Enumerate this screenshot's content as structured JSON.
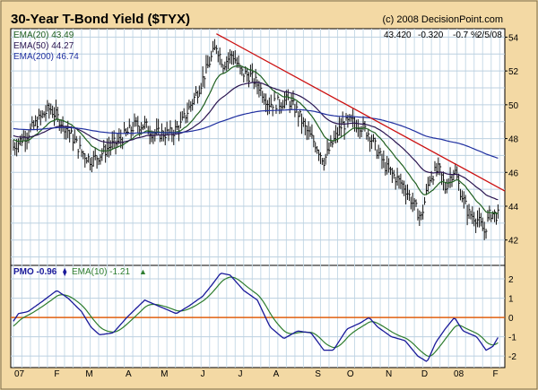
{
  "chart_data": {
    "type": "line",
    "title": "30-Year T-Bond Yield ($TYX)",
    "copyright": "(c) 2008 DecisionPoint.com",
    "quote": {
      "last": "43.420",
      "change": "-0.320",
      "pct": "-0.7 %",
      "date": "2/5/08"
    },
    "legend": [
      {
        "label": "EMA(20) 43.49",
        "color": "#1f5f1f",
        "period": 20
      },
      {
        "label": "EMA(50) 44.27",
        "color": "#2a1450",
        "period": 50
      },
      {
        "label": "EMA(200) 46.74",
        "color": "#2030a0",
        "period": 200
      }
    ],
    "price_ylim": [
      40.5,
      54.5
    ],
    "price_ticks": [
      "54",
      "52",
      "50",
      "48",
      "46",
      "44",
      "42"
    ],
    "xlim_weeks": [
      -0.3,
      57.6
    ],
    "month_labels": [
      {
        "label": "07",
        "week": 0.7
      },
      {
        "label": "F",
        "week": 5.1
      },
      {
        "label": "M",
        "week": 8.9
      },
      {
        "label": "A",
        "week": 13.5
      },
      {
        "label": "M",
        "week": 17.7
      },
      {
        "label": "J",
        "week": 22.2
      },
      {
        "label": "J",
        "week": 26.6
      },
      {
        "label": "A",
        "week": 30.8
      },
      {
        "label": "S",
        "week": 35.7
      },
      {
        "label": "O",
        "week": 39.5
      },
      {
        "label": "N",
        "week": 44.0
      },
      {
        "label": "D",
        "week": 48.2
      },
      {
        "label": "08",
        "week": 52.2
      },
      {
        "label": "F",
        "week": 56.5
      }
    ],
    "price_anchors": [
      [
        0,
        47.5
      ],
      [
        1.7,
        48.3
      ],
      [
        3.3,
        49.3
      ],
      [
        4.3,
        49.8
      ],
      [
        5.1,
        49.3
      ],
      [
        6.4,
        48.5
      ],
      [
        8,
        47.2
      ],
      [
        9.1,
        46.7
      ],
      [
        10.1,
        47
      ],
      [
        11.2,
        47.5
      ],
      [
        12.2,
        47.8
      ],
      [
        13.3,
        48.3
      ],
      [
        14.3,
        48.8
      ],
      [
        15.4,
        48.8
      ],
      [
        16.4,
        48.3
      ],
      [
        17.5,
        48.3
      ],
      [
        18.5,
        48.3
      ],
      [
        19.6,
        48.8
      ],
      [
        20.6,
        49.8
      ],
      [
        21.7,
        50.9
      ],
      [
        22.9,
        52.4
      ],
      [
        23.8,
        53.5
      ],
      [
        24.6,
        52.4
      ],
      [
        25.7,
        53
      ],
      [
        26.7,
        51.9
      ],
      [
        27.8,
        51.7
      ],
      [
        28.8,
        51.1
      ],
      [
        29.9,
        50.1
      ],
      [
        31.2,
        50.1
      ],
      [
        32.2,
        50.3
      ],
      [
        33.3,
        49.6
      ],
      [
        34.3,
        48.5
      ],
      [
        35.4,
        47.7
      ],
      [
        36.4,
        46.7
      ],
      [
        37.5,
        47.8
      ],
      [
        38.5,
        48.8
      ],
      [
        39.6,
        49
      ],
      [
        40.6,
        48.8
      ],
      [
        41.7,
        48.3
      ],
      [
        42.7,
        47.2
      ],
      [
        43.8,
        46.2
      ],
      [
        44.8,
        45.7
      ],
      [
        45.9,
        45.1
      ],
      [
        46.9,
        44.1
      ],
      [
        47.8,
        43.3
      ],
      [
        48.8,
        45.7
      ],
      [
        49.9,
        46.2
      ],
      [
        50.6,
        45.1
      ],
      [
        51.7,
        46.2
      ],
      [
        52.4,
        44.9
      ],
      [
        53.3,
        43.6
      ],
      [
        54.3,
        43.3
      ],
      [
        55.2,
        42.5
      ],
      [
        55.9,
        43.6
      ],
      [
        56.9,
        43.42
      ]
    ],
    "trendline": [
      [
        23.8,
        54.2
      ],
      [
        57.6,
        44.9
      ]
    ],
    "pmo": {
      "legend_pmo": "PMO  -0.96",
      "legend_ema": "EMA(10)  -1.21",
      "pmo_color": "#1a1a9a",
      "ema_color": "#2e7d2e",
      "zero_color": "#e06010",
      "ylim": [
        -2.6,
        2.7
      ],
      "ticks": [
        "2",
        "1",
        "0",
        "-1",
        "-2"
      ],
      "anchors": [
        [
          0,
          -0.2
        ],
        [
          0.6,
          0.2
        ],
        [
          1.7,
          0.3
        ],
        [
          3.3,
          0.8
        ],
        [
          5.1,
          1.4
        ],
        [
          6.4,
          1.0
        ],
        [
          8,
          0.3
        ],
        [
          9.1,
          -0.5
        ],
        [
          10.1,
          -0.9
        ],
        [
          11.7,
          -0.8
        ],
        [
          13.3,
          0
        ],
        [
          15.4,
          0.9
        ],
        [
          17.5,
          0.5
        ],
        [
          19.1,
          0.2
        ],
        [
          20.6,
          0.6
        ],
        [
          22.2,
          1.1
        ],
        [
          23.3,
          1.7
        ],
        [
          24.3,
          2.3
        ],
        [
          25.4,
          2.2
        ],
        [
          27,
          1.4
        ],
        [
          28.6,
          0.9
        ],
        [
          30.1,
          -0.5
        ],
        [
          31.7,
          -1.1
        ],
        [
          33.3,
          -0.7
        ],
        [
          34.9,
          -0.8
        ],
        [
          36.4,
          -1.7
        ],
        [
          37.5,
          -1.7
        ],
        [
          39.1,
          -0.6
        ],
        [
          40.6,
          -0.3
        ],
        [
          41.7,
          0
        ],
        [
          42.7,
          -0.5
        ],
        [
          44.3,
          -1.0
        ],
        [
          45.9,
          -1.2
        ],
        [
          47.4,
          -2.0
        ],
        [
          48.5,
          -2.3
        ],
        [
          49.5,
          -1.3
        ],
        [
          50.6,
          -0.6
        ],
        [
          51.7,
          0
        ],
        [
          52.7,
          -0.7
        ],
        [
          54.3,
          -1.0
        ],
        [
          55.4,
          -1.7
        ],
        [
          56.2,
          -1.5
        ],
        [
          56.9,
          -0.96
        ]
      ]
    }
  }
}
